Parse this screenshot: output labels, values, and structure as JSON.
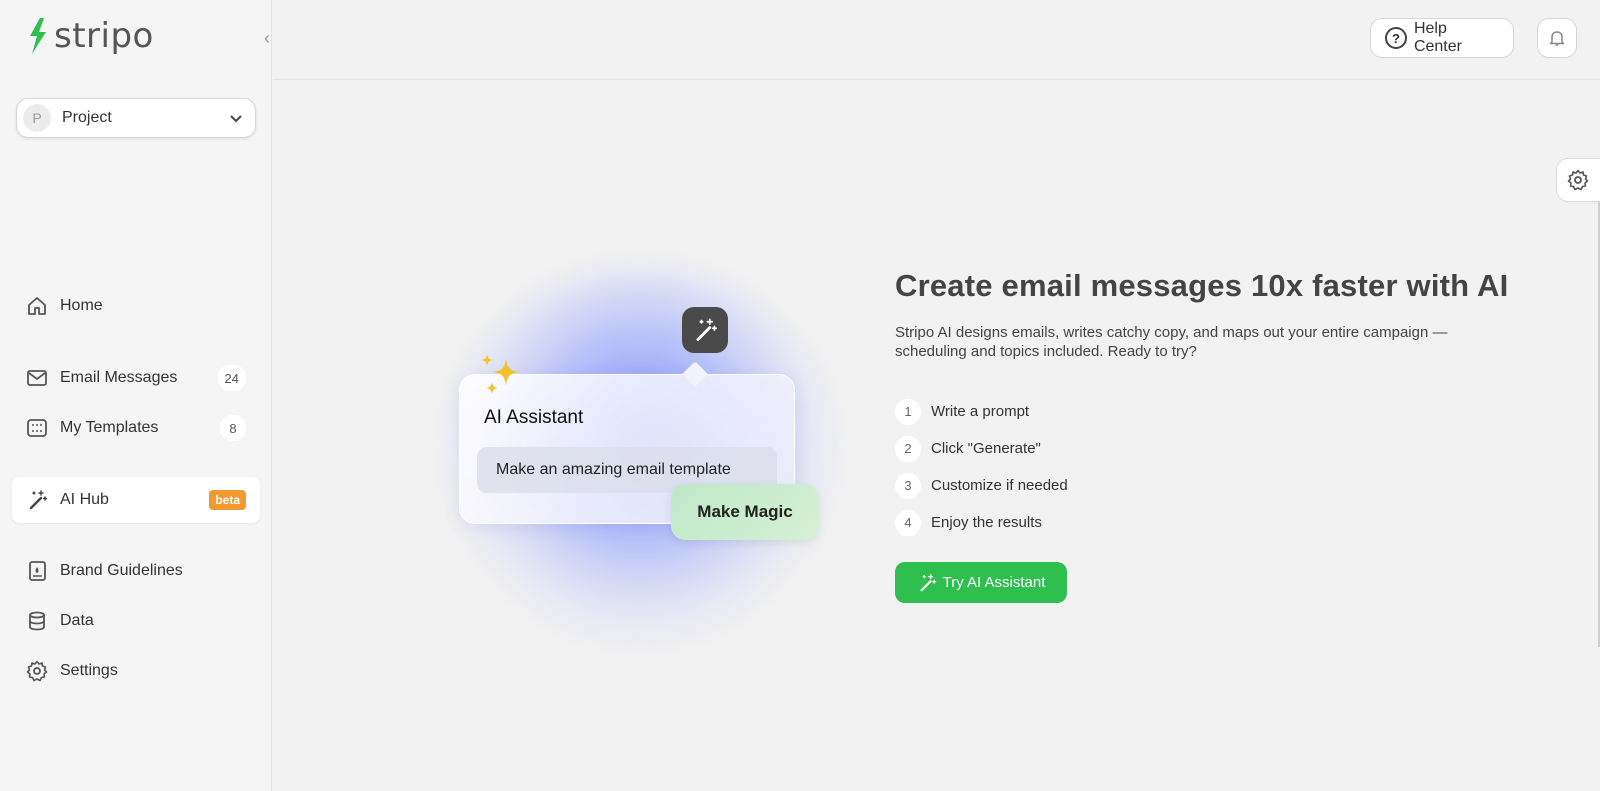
{
  "brand": {
    "logo_text": "stripo",
    "logo_color": "#2fbf4f"
  },
  "sidebar": {
    "project": {
      "avatar_letter": "P",
      "label": "Project"
    },
    "items": [
      {
        "label": "Home",
        "icon": "home-icon"
      },
      {
        "label": "Email Messages",
        "icon": "envelope-icon",
        "count": "24"
      },
      {
        "label": "My Templates",
        "icon": "templates-icon",
        "count": "8"
      },
      {
        "label": "AI Hub",
        "icon": "magic-wand-icon",
        "badge": "beta",
        "active": true
      },
      {
        "label": "Brand Guidelines",
        "icon": "brand-book-icon"
      },
      {
        "label": "Data",
        "icon": "database-icon"
      },
      {
        "label": "Settings",
        "icon": "gear-icon"
      }
    ]
  },
  "header": {
    "help_label": "Help Center"
  },
  "illustration": {
    "card_title": "AI Assistant",
    "prompt_text": "Make an amazing email template",
    "magic_button": "Make Magic"
  },
  "main": {
    "headline": "Create email messages 10x faster with AI",
    "description": "Stripo AI designs emails, writes catchy copy, and maps out your entire campaign — scheduling and topics included. Ready to try?",
    "steps": [
      {
        "num": "1",
        "text": "Write a prompt"
      },
      {
        "num": "2",
        "text": "Click \"Generate\""
      },
      {
        "num": "3",
        "text": "Customize if needed"
      },
      {
        "num": "4",
        "text": "Enjoy the results"
      }
    ],
    "cta_label": "Try AI Assistant"
  },
  "colors": {
    "accent": "#2fbf4f",
    "beta": "#f19a30",
    "background": "#f2f2f2"
  }
}
